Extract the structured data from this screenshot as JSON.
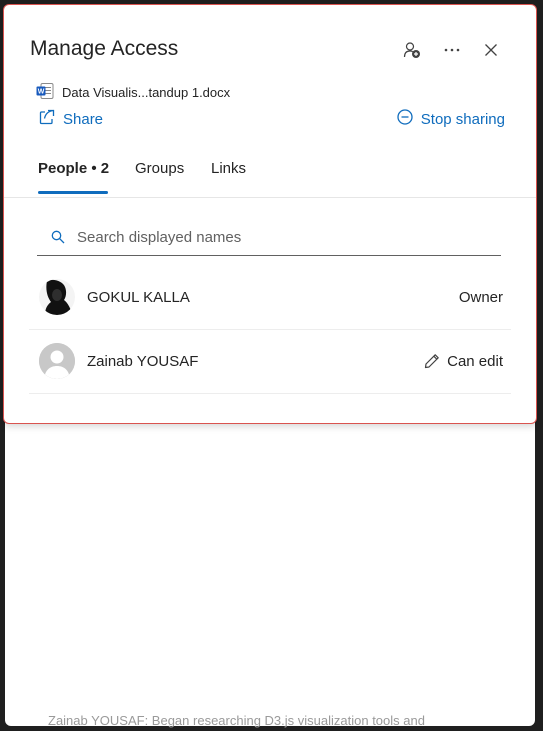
{
  "panel": {
    "title": "Manage Access",
    "file_name": "Data Visualis...tandup 1.docx",
    "share_label": "Share",
    "stop_sharing_label": "Stop sharing"
  },
  "tabs": [
    {
      "label": "People • 2"
    },
    {
      "label": "Groups"
    },
    {
      "label": "Links"
    }
  ],
  "search": {
    "placeholder": "Search displayed names",
    "value": ""
  },
  "people": [
    {
      "name": "GOKUL KALLA",
      "role": "Owner"
    },
    {
      "name": "Zainab YOUSAF",
      "role": "Can edit"
    }
  ],
  "background_text": "Zainab YOUSAF: Began researching D3.js visualization tools and",
  "colors": {
    "accent": "#0f6cbd",
    "border_highlight": "#d9534f",
    "word_blue": "#185abd"
  }
}
